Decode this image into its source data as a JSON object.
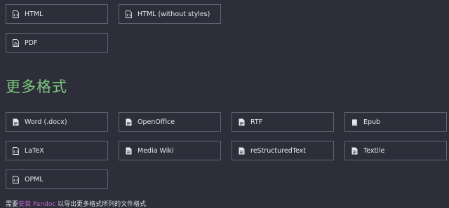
{
  "top_formats": [
    {
      "label": "HTML",
      "icon": "file-code-icon"
    },
    {
      "label": "HTML (without styles)",
      "icon": "file-code-icon"
    },
    {
      "label": "PDF",
      "icon": "file-pdf-icon"
    }
  ],
  "more_formats_heading": "更多格式",
  "more_formats": [
    {
      "label": "Word (.docx)",
      "icon": "file-text-icon"
    },
    {
      "label": "OpenOffice",
      "icon": "file-text-icon"
    },
    {
      "label": "RTF",
      "icon": "file-text-icon"
    },
    {
      "label": "Epub",
      "icon": "book-icon"
    },
    {
      "label": "LaTeX",
      "icon": "file-code-icon"
    },
    {
      "label": "Media Wiki",
      "icon": "file-text-icon"
    },
    {
      "label": "reStructuredText",
      "icon": "file-text-icon"
    },
    {
      "label": "Textile",
      "icon": "file-text-icon"
    },
    {
      "label": "OPML",
      "icon": "file-code-icon"
    }
  ],
  "footnote": {
    "prefix": "需要",
    "link": "安装 Pandoc",
    "suffix": " 以导出更多格式所列的文件格式"
  }
}
